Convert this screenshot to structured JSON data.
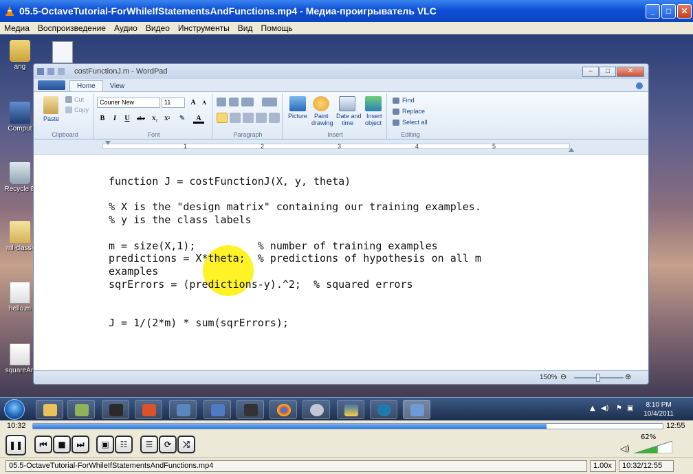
{
  "vlc": {
    "title": "05.5-OctaveTutorial-ForWhileIfStatementsAndFunctions.mp4 - Медиа-проигрыватель VLC",
    "window_buttons": [
      "_",
      "□",
      "✕"
    ],
    "menu": [
      "Медиа",
      "Воспроизведение",
      "Аудио",
      "Видео",
      "Инструменты",
      "Вид",
      "Помощь"
    ],
    "time_elapsed": "10:32",
    "time_total": "12:55",
    "progress_fraction": 0.815,
    "volume_label": "62%",
    "volume_fraction": 0.62,
    "status_file": "05.5-OctaveTutorial-ForWhileIfStatementsAndFunctions.mp4",
    "status_speed": "1.00x",
    "status_time": "10:32/12:55"
  },
  "desktop": {
    "icons": [
      "ang",
      "Comput",
      "Recycle B",
      "ml-class-",
      "hello.m",
      "squareAn"
    ]
  },
  "wordpad": {
    "title": "costFunctionJ.m - WordPad",
    "tabs": [
      "Home",
      "View"
    ],
    "clipboard": {
      "paste": "Paste",
      "cut": "Cut",
      "copy": "Copy",
      "label": "Clipboard"
    },
    "font": {
      "family": "Courier New",
      "size": "11",
      "label": "Font"
    },
    "paragraph_label": "Paragraph",
    "insert": {
      "picture": "Picture",
      "paint1": "Paint",
      "paint2": "drawing",
      "date1": "Date and",
      "date2": "time",
      "obj1": "Insert",
      "obj2": "object",
      "label": "Insert"
    },
    "editing": {
      "find": "Find",
      "replace": "Replace",
      "select_all": "Select all",
      "label": "Editing"
    },
    "ruler": [
      "1",
      "2",
      "3",
      "4",
      "5"
    ],
    "code": [
      "function J = costFunctionJ(X, y, theta)",
      "",
      "% X is the \"design matrix\" containing our training examples.",
      "% y is the class labels",
      "",
      "m = size(X,1);          % number of training examples",
      "predictions = X*theta;  % predictions of hypothesis on all m",
      "examples",
      "sqrErrors = (predictions-y).^2;  % squared errors",
      "",
      "",
      "J = 1/(2*m) * sum(sqrErrors);"
    ],
    "zoom": "150%"
  },
  "taskbar": {
    "clock_time": "8:10 PM",
    "clock_date": "10/4/2011"
  }
}
